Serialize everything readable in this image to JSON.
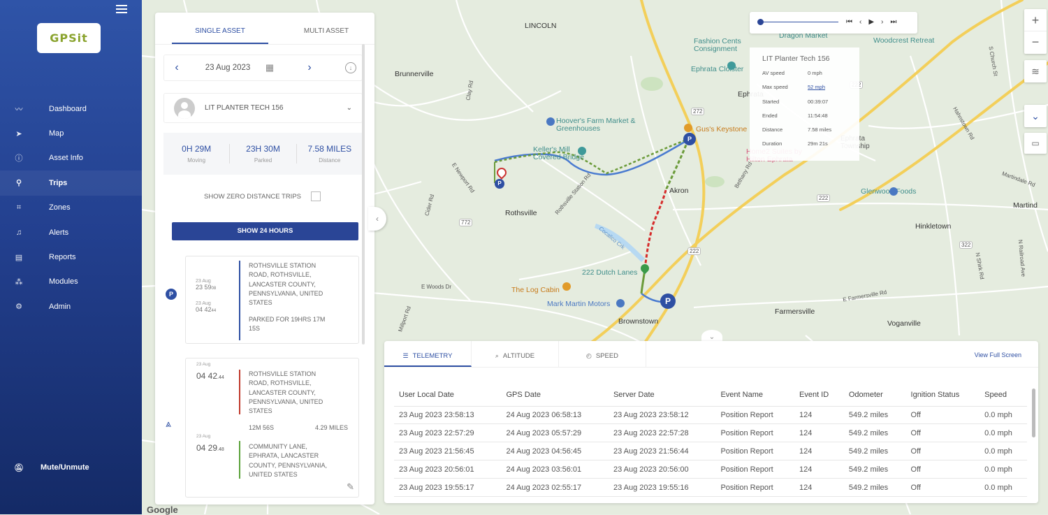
{
  "sidebar": {
    "logo": "GPSit",
    "items": [
      {
        "label": "Dashboard",
        "icon": "chart-line-icon"
      },
      {
        "label": "Map",
        "icon": "navigation-icon"
      },
      {
        "label": "Asset Info",
        "icon": "info-icon"
      },
      {
        "label": "Trips",
        "icon": "route-icon"
      },
      {
        "label": "Zones",
        "icon": "zone-icon"
      },
      {
        "label": "Alerts",
        "icon": "bell-icon"
      },
      {
        "label": "Reports",
        "icon": "document-icon"
      },
      {
        "label": "Modules",
        "icon": "modules-icon"
      },
      {
        "label": "Admin",
        "icon": "gear-icon"
      }
    ],
    "mute_label": "Mute/Unmute"
  },
  "panel": {
    "tabs": [
      "SINGLE ASSET",
      "MULTI ASSET"
    ],
    "date": "23 Aug 2023",
    "asset_name": "LIT PLANTER TECH 156",
    "stats": [
      {
        "value": "0H 29M",
        "label": "Moving"
      },
      {
        "value": "23H 30M",
        "label": "Parked"
      },
      {
        "value": "7.58 MILES",
        "label": "Distance"
      }
    ],
    "zero_trips_label": "SHOW ZERO DISTANCE TRIPS",
    "show24_label": "SHOW 24 HOURS",
    "card1": {
      "date1": "23 Aug",
      "time1": "23 59",
      "sec1": "08",
      "date2": "23 Aug",
      "time2": "04 42",
      "sec2": "44",
      "address": "ROTHSVILLE STATION ROAD, ROTHSVILLE, LANCASTER COUNTY, PENNSYLVANIA, UNITED STATES",
      "parked": "PARKED FOR 19HRS 17M 15S",
      "badge": "P"
    },
    "card2": {
      "date1": "23 Aug",
      "time1": "04 42",
      "sec1": ".44",
      "address1": "ROTHSVILLE STATION ROAD, ROTHSVILLE, LANCASTER COUNTY, PENNSYLVANIA, UNITED STATES",
      "duration": "12M 56S",
      "distance": "4.29 MILES",
      "date2": "23 Aug",
      "time2": "04 29",
      "sec2": ".48",
      "address2": "COMMUNITY LANE, EPHRATA, LANCASTER COUNTY, PENNSYLVANIA, UNITED STATES"
    }
  },
  "info": {
    "title": "LIT Planter Tech 156",
    "rows": [
      {
        "k": "AV speed",
        "v": "0 mph"
      },
      {
        "k": "Max speed",
        "v": "52 mph"
      },
      {
        "k": "Started",
        "v": "00:39:07"
      },
      {
        "k": "Ended",
        "v": "11:54:48"
      },
      {
        "k": "Distance",
        "v": "7.58 miles"
      },
      {
        "k": "Duration",
        "v": "29m 21s"
      }
    ]
  },
  "map": {
    "labels": {
      "lincoln": "LINCOLN",
      "brunnerville": "Brunnerville",
      "fashion": "Fashion Cents Consignment",
      "cloister": "Ephrata Cloister",
      "ephrata": "Ephrata",
      "hoovers": "Hoover's Farm Market & Greenhouses",
      "kellers": "Keller's Mill Covered Bridge",
      "gus": "Gus's Keystone",
      "rothsville": "Rothsville",
      "akron": "Akron",
      "dutch": "222 Dutch Lanes",
      "logcabin": "The Log Cabin",
      "markmartin": "Mark Martin Motors",
      "brownstown": "Brownstown",
      "farmersville": "Farmersville",
      "voganville": "Voganville",
      "hinkletown": "Hinkletown",
      "glenwood": "Glenwood Foods",
      "woodcrest": "Woodcrest Retreat",
      "greendragon": "The Green Dragon Market",
      "homesuites": "Home2 Suites by Hilton Ephrata",
      "ephratatwp": "Ephrata Township",
      "martind": "Martind",
      "cocalico": "Cocalico Crk",
      "e_newport": "E Newport Rd",
      "cider": "Cider Rd",
      "clay": "Clay Rd",
      "e_woods": "E Woods Dr",
      "millport": "Millport Rd",
      "rothsville_station": "Rothsville Station Rd",
      "bethany": "Bethany Rd",
      "e_farmersville": "E Farmersville Rd",
      "martindale": "Martindale Rd",
      "hahnstown": "Hahnstown Rd",
      "n_shirk": "N Shirk Rd",
      "s_church": "S Church St",
      "n_railroad": "N Railroad Ave",
      "r272": "272",
      "r222": "222",
      "r772": "772",
      "r322": "322",
      "google": "Google"
    }
  },
  "telemetry": {
    "tabs": [
      {
        "label": "TELEMETRY",
        "icon": "database-icon"
      },
      {
        "label": "ALTITUDE",
        "icon": "altitude-icon"
      },
      {
        "label": "SPEED",
        "icon": "speedometer-icon"
      }
    ],
    "fullscreen": "View Full Screen",
    "columns": [
      "User Local Date",
      "GPS Date",
      "Server Date",
      "Event Name",
      "Event ID",
      "Odometer",
      "Ignition Status",
      "Speed"
    ],
    "rows": [
      [
        "23 Aug 2023 23:58:13",
        "24 Aug 2023 06:58:13",
        "23 Aug 2023 23:58:12",
        "Position Report",
        "124",
        "549.2 miles",
        "Off",
        "0.0 mph"
      ],
      [
        "23 Aug 2023 22:57:29",
        "24 Aug 2023 05:57:29",
        "23 Aug 2023 22:57:28",
        "Position Report",
        "124",
        "549.2 miles",
        "Off",
        "0.0 mph"
      ],
      [
        "23 Aug 2023 21:56:45",
        "24 Aug 2023 04:56:45",
        "23 Aug 2023 21:56:44",
        "Position Report",
        "124",
        "549.2 miles",
        "Off",
        "0.0 mph"
      ],
      [
        "23 Aug 2023 20:56:01",
        "24 Aug 2023 03:56:01",
        "23 Aug 2023 20:56:00",
        "Position Report",
        "124",
        "549.2 miles",
        "Off",
        "0.0 mph"
      ],
      [
        "23 Aug 2023 19:55:17",
        "24 Aug 2023 02:55:17",
        "23 Aug 2023 19:55:16",
        "Position Report",
        "124",
        "549.2 miles",
        "Off",
        "0.0 mph"
      ]
    ]
  },
  "colors": {
    "primary": "#2a4596",
    "route_green": "#6b9b3a",
    "route_red": "#d62b2b",
    "route_blue": "#4a7bd0"
  }
}
